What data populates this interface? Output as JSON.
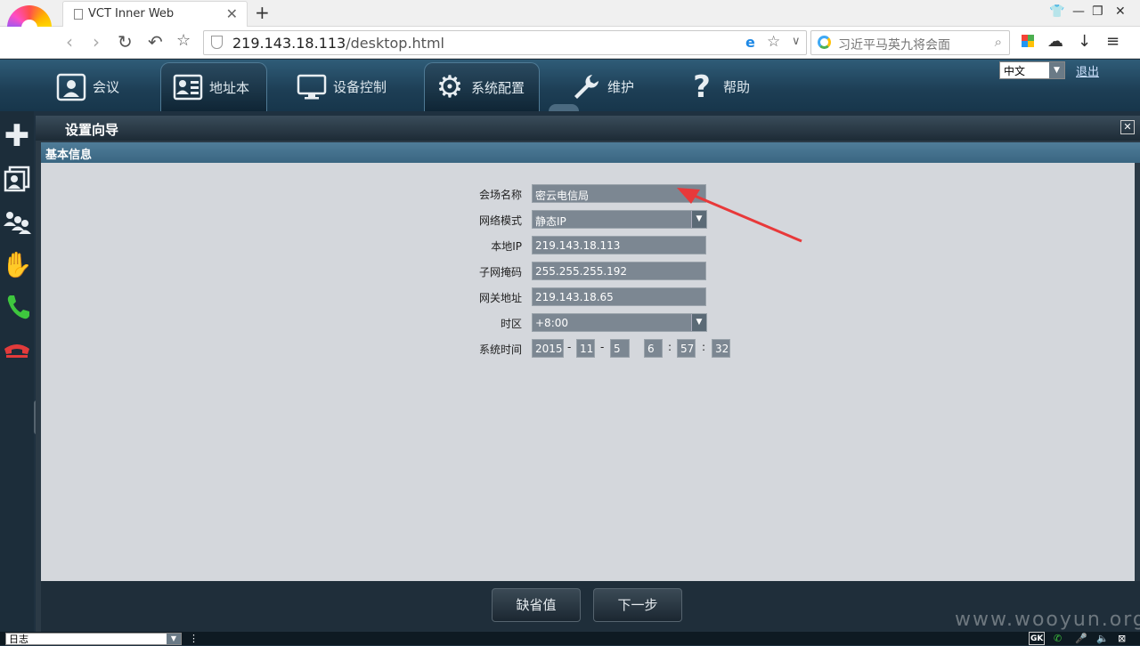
{
  "browser": {
    "tab_title": "VCT Inner Web",
    "url_host": "219.143.18.113",
    "url_path": "/desktop.html",
    "search_placeholder": "习近平马英九将会面"
  },
  "app": {
    "menu": [
      {
        "label": "会议",
        "icon": "meeting-icon"
      },
      {
        "label": "地址本",
        "icon": "address-book-icon"
      },
      {
        "label": "设备控制",
        "icon": "monitor-icon"
      },
      {
        "label": "系统配置",
        "icon": "gear-icon"
      },
      {
        "label": "维护",
        "icon": "wrench-icon"
      },
      {
        "label": "帮助",
        "icon": "question-icon"
      }
    ],
    "active_menu": "系统配置",
    "language": "中文",
    "logout": "退出"
  },
  "panel": {
    "title": "设置向导",
    "section": "基本信息",
    "fields": {
      "venue_name": {
        "label": "会场名称",
        "value": "密云电信局"
      },
      "network_mode": {
        "label": "网络模式",
        "value": "静态IP"
      },
      "local_ip": {
        "label": "本地IP",
        "value": "219.143.18.113"
      },
      "subnet_mask": {
        "label": "子网掩码",
        "value": "255.255.255.192"
      },
      "gateway": {
        "label": "网关地址",
        "value": "219.143.18.65"
      },
      "timezone": {
        "label": "时区",
        "value": "+8:00"
      },
      "system_time": {
        "label": "系统时间",
        "year": "2015",
        "month": "11",
        "day": "5",
        "hour": "6",
        "minute": "57",
        "second": "32"
      }
    },
    "buttons": {
      "defaults": "缺省值",
      "next": "下一步"
    }
  },
  "statusbar": {
    "log": "日志",
    "gk": "GK"
  },
  "watermark": "www.wooyun.org"
}
